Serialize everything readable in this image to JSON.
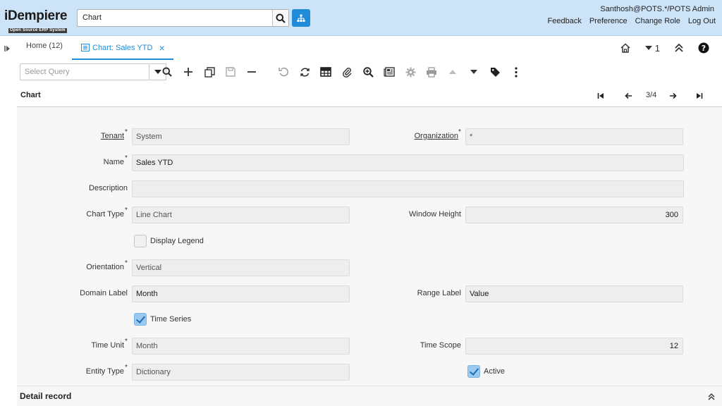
{
  "app": {
    "logo_text": "iDempiere",
    "logo_subtext": "Open Source ERP System",
    "search_value": "Chart",
    "user": "Santhosh@POTS.*/POTS Admin",
    "links": [
      "Feedback",
      "Preference",
      "Change Role",
      "Log Out"
    ]
  },
  "tabs": {
    "home": "Home (12)",
    "active": "Chart: Sales YTD",
    "close_glyph": "×",
    "count": "1"
  },
  "toolbar": {
    "query_placeholder": "Select Query"
  },
  "window": {
    "title": "Chart",
    "record_nav": "3/4"
  },
  "form": {
    "tenant_label": "Tenant",
    "tenant_value": "System",
    "org_label": "Organization",
    "org_value": "*",
    "name_label": "Name",
    "name_value": "Sales YTD",
    "description_label": "Description",
    "description_value": "",
    "chart_type_label": "Chart Type",
    "chart_type_value": "Line Chart",
    "window_height_label": "Window Height",
    "window_height_value": "300",
    "display_legend_label": "Display Legend",
    "display_legend_checked": false,
    "orientation_label": "Orientation",
    "orientation_value": "Vertical",
    "domain_label_label": "Domain Label",
    "domain_label_value": "Month",
    "range_label_label": "Range Label",
    "range_label_value": "Value",
    "time_series_label": "Time Series",
    "time_series_checked": true,
    "time_unit_label": "Time Unit",
    "time_unit_value": "Month",
    "time_scope_label": "Time Scope",
    "time_scope_value": "12",
    "entity_type_label": "Entity Type",
    "entity_type_value": "Dictionary",
    "active_label": "Active",
    "active_checked": true,
    "required_mark": "*"
  },
  "detail": {
    "title": "Detail record"
  },
  "colors": {
    "header_bg": "#cde3f7",
    "accent": "#1f8bd9",
    "field_bg": "#eeeeee",
    "form_bg": "#f7f7f7"
  }
}
